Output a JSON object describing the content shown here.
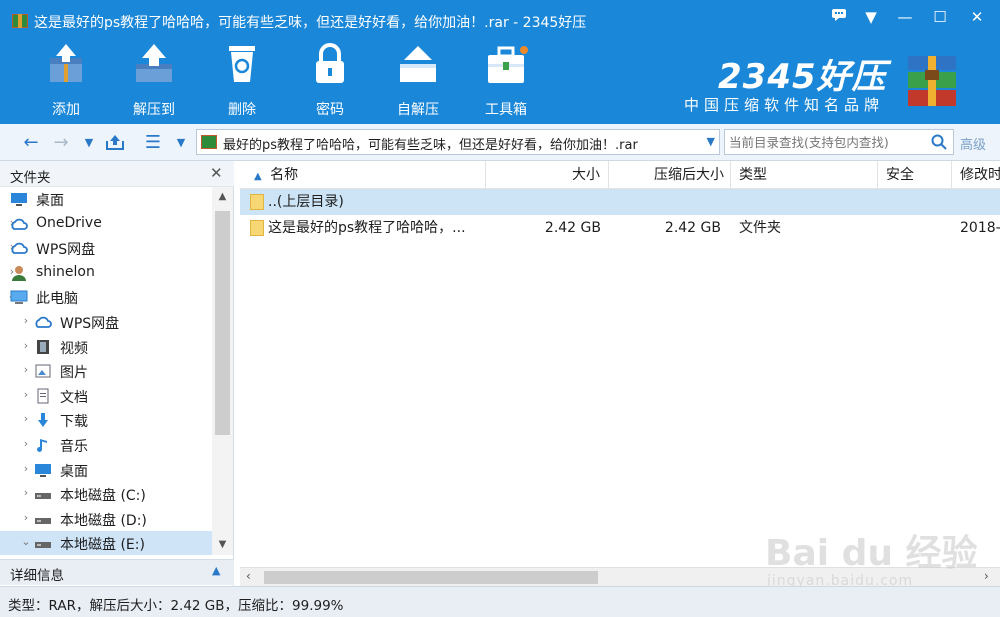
{
  "window": {
    "title": "这是最好的ps教程了哈哈哈，可能有些乏味，但还是好好看，给你加油！.rar - 2345好压",
    "controls": {
      "menu": "▼",
      "minimize": "—",
      "maximize": "☐",
      "close": "✕"
    }
  },
  "toolbar": {
    "items": [
      {
        "label": "添加",
        "icon": "add-box-icon"
      },
      {
        "label": "解压到",
        "icon": "extract-to-icon"
      },
      {
        "label": "删除",
        "icon": "recycle-bin-icon"
      },
      {
        "label": "密码",
        "icon": "lock-icon"
      },
      {
        "label": "自解压",
        "icon": "self-extract-icon"
      },
      {
        "label": "工具箱",
        "icon": "toolbox-icon"
      }
    ]
  },
  "brand": {
    "name": "2345好压",
    "slogan": "中国压缩软件知名品牌"
  },
  "address": {
    "path": "最好的ps教程了哈哈哈，可能有些乏味，但还是好好看，给你加油！.rar",
    "search_placeholder": "当前目录查找(支持包内查找)",
    "advanced": "高级"
  },
  "left_panel": {
    "title": "文件夹",
    "close": "✕",
    "tree": [
      {
        "label": "桌面",
        "icon": "desktop-icon",
        "level": 0,
        "expand": ""
      },
      {
        "label": "OneDrive",
        "icon": "cloud-icon",
        "level": 0,
        "expand": "›"
      },
      {
        "label": "WPS网盘",
        "icon": "cloud-icon",
        "level": 0,
        "expand": "›"
      },
      {
        "label": "shinelon",
        "icon": "user-icon",
        "level": 0,
        "expand": "›"
      },
      {
        "label": "此电脑",
        "icon": "computer-icon",
        "level": 0,
        "expand": "⌄"
      },
      {
        "label": "WPS网盘",
        "icon": "cloud-icon",
        "level": 1,
        "expand": "›"
      },
      {
        "label": "视频",
        "icon": "video-icon",
        "level": 1,
        "expand": "›"
      },
      {
        "label": "图片",
        "icon": "picture-icon",
        "level": 1,
        "expand": "›"
      },
      {
        "label": "文档",
        "icon": "document-icon",
        "level": 1,
        "expand": "›"
      },
      {
        "label": "下载",
        "icon": "download-icon",
        "level": 1,
        "expand": "›"
      },
      {
        "label": "音乐",
        "icon": "music-icon",
        "level": 1,
        "expand": "›"
      },
      {
        "label": "桌面",
        "icon": "desktop-icon",
        "level": 1,
        "expand": "›"
      },
      {
        "label": "本地磁盘 (C:)",
        "icon": "drive-icon",
        "level": 1,
        "expand": "›"
      },
      {
        "label": "本地磁盘 (D:)",
        "icon": "drive-icon",
        "level": 1,
        "expand": "›"
      },
      {
        "label": "本地磁盘 (E:)",
        "icon": "drive-icon",
        "level": 1,
        "expand": "⌄",
        "selected": true
      }
    ],
    "detail_label": "详细信息"
  },
  "file_list": {
    "columns": [
      "名称",
      "大小",
      "压缩后大小",
      "类型",
      "安全",
      "修改时"
    ],
    "rows": [
      {
        "name": "..(上层目录)",
        "size": "",
        "packed": "",
        "type": "",
        "security": "",
        "modified": "",
        "selected": true
      },
      {
        "name": "这是最好的ps教程了哈哈哈，...",
        "size": "2.42 GB",
        "packed": "2.42 GB",
        "type": "文件夹",
        "security": "",
        "modified": "2018-"
      }
    ]
  },
  "status": {
    "text": "类型：RAR，解压后大小：2.42 GB，压缩比：99.99%"
  },
  "watermark": {
    "main": "Bai du 经验",
    "sub": "jingyan.baidu.com"
  },
  "colors": {
    "band": "#1a87d8",
    "selection": "#cde4f7",
    "accent": "#2a79c9"
  }
}
